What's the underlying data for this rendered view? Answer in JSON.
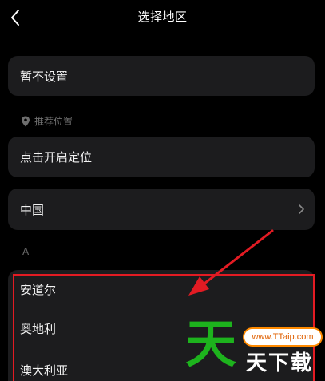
{
  "header": {
    "title": "选择地区",
    "back_icon": "chevron-left-icon"
  },
  "no_set": {
    "label": "暂不设置"
  },
  "recommended": {
    "label": "推荐位置",
    "icon": "location-pin-icon"
  },
  "locate": {
    "label": "点击开启定位"
  },
  "china": {
    "label": "中国",
    "icon": "chevron-right-icon"
  },
  "section_a": {
    "letter": "A",
    "items": [
      "安道尔",
      "奥地利",
      "澳大利亚"
    ]
  },
  "annotation": {
    "box_color": "#e21b23",
    "arrow_color": "#e21b23"
  },
  "watermark": {
    "big_char": "天",
    "url": "www.TTaip.com",
    "sub_text": "天下载"
  }
}
